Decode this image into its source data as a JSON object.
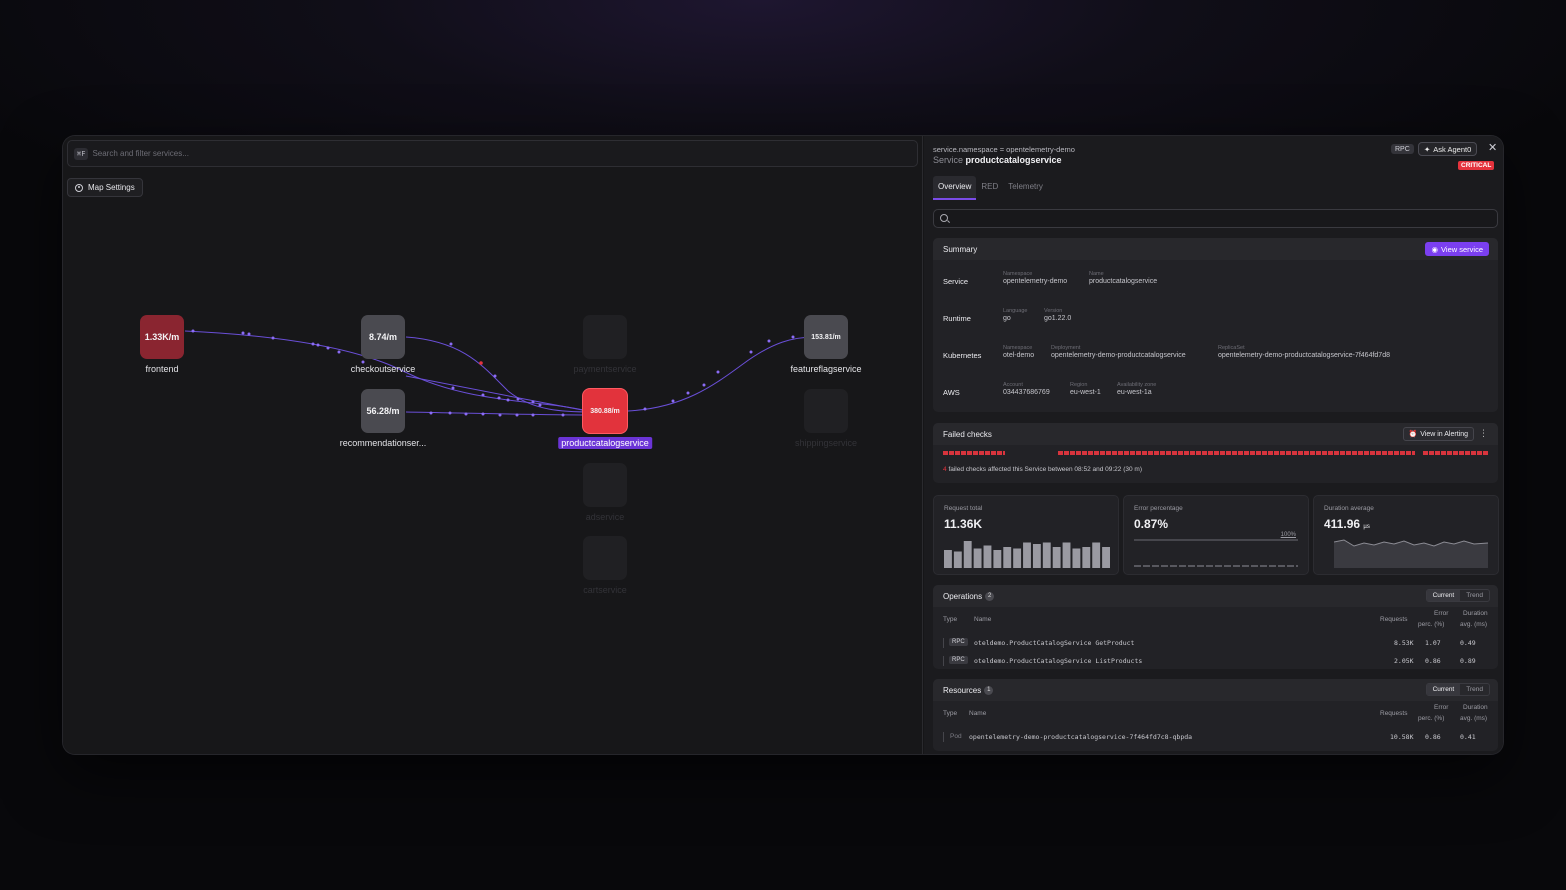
{
  "map": {
    "search_shortcut": "⌘F",
    "search_placeholder": "Search and filter services...",
    "settings_label": "Map Settings",
    "nodes": {
      "frontend": {
        "value": "1.33K/m",
        "label": "frontend"
      },
      "checkout": {
        "value": "8.74/m",
        "label": "checkoutservice"
      },
      "recommendation": {
        "value": "56.28/m",
        "label": "recommendationser..."
      },
      "productcatalog": {
        "value": "380.88/m",
        "label": "productcatalogservice"
      },
      "featureflag": {
        "value": "153.81/m",
        "label": "featureflagservice"
      },
      "payment": {
        "label": "paymentservice"
      },
      "shipping": {
        "label": "shippingservice"
      },
      "ad": {
        "label": "adservice"
      },
      "cart": {
        "label": "cartservice"
      }
    }
  },
  "panel": {
    "namespace_filter": "service.namespace = opentelemetry-demo",
    "service_prefix": "Service",
    "service_name": "productcatalogservice",
    "rpc_tag": "RPC",
    "ask_label": "Ask Agent0",
    "status": "CRITICAL",
    "tabs": [
      "Overview",
      "RED",
      "Telemetry"
    ],
    "summary": {
      "title": "Summary",
      "view_button": "View service",
      "service": {
        "label": "Service",
        "namespace_k": "Namespace",
        "namespace_v": "opentelemetry-demo",
        "name_k": "Name",
        "name_v": "productcatalogservice"
      },
      "runtime": {
        "label": "Runtime",
        "language_k": "Language",
        "language_v": "go",
        "version_k": "Version",
        "version_v": "go1.22.0"
      },
      "kubernetes": {
        "label": "Kubernetes",
        "namespace_k": "Namespace",
        "namespace_v": "otel-demo",
        "deployment_k": "Deployment",
        "deployment_v": "opentelemetry-demo-productcatalogservice",
        "replicaset_k": "ReplicaSet",
        "replicaset_v": "opentelemetry-demo-productcatalogservice-7f464fd7d8"
      },
      "aws": {
        "label": "AWS",
        "account_k": "Account",
        "account_v": "034437686769",
        "region_k": "Region",
        "region_v": "eu-west-1",
        "zone_k": "Availability zone",
        "zone_v": "eu-west-1a"
      }
    },
    "failed_checks": {
      "title": "Failed checks",
      "alert_button": "View in Alerting",
      "count": "4",
      "text": "failed checks affected this Service between 08:52 and 09:22 (30 m)"
    },
    "metrics": {
      "request": {
        "label": "Request total",
        "value": "11.36K",
        "bars": [
          0.6,
          0.55,
          0.9,
          0.65,
          0.75,
          0.6,
          0.7,
          0.65,
          0.85,
          0.8,
          0.85,
          0.7,
          0.85,
          0.65,
          0.7,
          0.85,
          0.7
        ]
      },
      "error": {
        "label": "Error percentage",
        "value": "0.87%",
        "max_label": "100%"
      },
      "duration": {
        "label": "Duration average",
        "value": "411.96",
        "unit": "µs"
      }
    },
    "operations": {
      "title": "Operations",
      "count": "2",
      "seg": [
        "Current",
        "Trend"
      ],
      "headers": {
        "type": "Type",
        "name": "Name",
        "requests": "Requests",
        "err1": "Error",
        "err2": "perc. (%)",
        "dur1": "Duration",
        "dur2": "avg. (ms)"
      },
      "rows": [
        {
          "type": "RPC",
          "name": "oteldemo.ProductCatalogService GetProduct",
          "requests": "8.53K",
          "error": "1.07",
          "duration": "0.49"
        },
        {
          "type": "RPC",
          "name": "oteldemo.ProductCatalogService ListProducts",
          "requests": "2.05K",
          "error": "0.86",
          "duration": "0.89"
        }
      ]
    },
    "resources": {
      "title": "Resources",
      "count": "1",
      "seg": [
        "Current",
        "Trend"
      ],
      "headers": {
        "type": "Type",
        "name": "Name",
        "requests": "Requests",
        "err1": "Error",
        "err2": "perc. (%)",
        "dur1": "Duration",
        "dur2": "avg. (ms)"
      },
      "rows": [
        {
          "type": "Pod",
          "name": "opentelemetry-demo-productcatalogservice-7f464fd7c8-qbpda",
          "requests": "10.58K",
          "error": "0.86",
          "duration": "0.41"
        }
      ]
    }
  },
  "colors": {
    "accent": "#7b3ff0",
    "critical": "#e5333d",
    "edge": "#7a5cf0"
  }
}
